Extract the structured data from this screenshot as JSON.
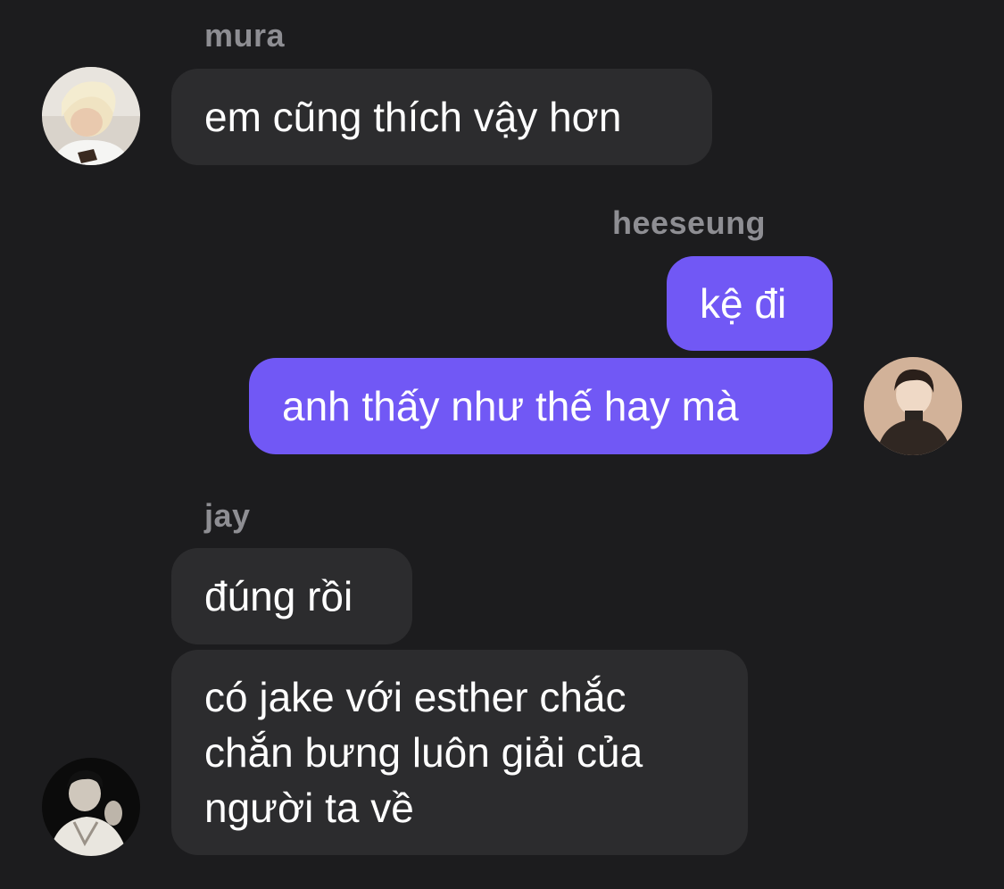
{
  "messages": [
    {
      "sender": "mura",
      "side": "incoming",
      "avatar_icon": "user-avatar-mura",
      "bubbles": [
        "em cũng thích vậy hơn"
      ]
    },
    {
      "sender": "heeseung",
      "side": "outgoing",
      "avatar_icon": "user-avatar-heeseung",
      "bubbles": [
        "kệ đi",
        "anh thấy như thế hay mà"
      ]
    },
    {
      "sender": "jay",
      "side": "incoming",
      "avatar_icon": "user-avatar-jay",
      "bubbles": [
        "đúng rồi",
        "có jake với esther chắc\nchắn bưng luôn giải của\nngười ta về"
      ]
    }
  ],
  "jay_multiline": [
    "có jake với esther chắc",
    "chắn bưng luôn giải của",
    "người ta về"
  ],
  "colors": {
    "background": "#1c1c1e",
    "incoming_bubble": "#2c2c2e",
    "outgoing_bubble": "#7158f5",
    "sender_name": "#8e8e93",
    "message_text": "#ffffff"
  }
}
